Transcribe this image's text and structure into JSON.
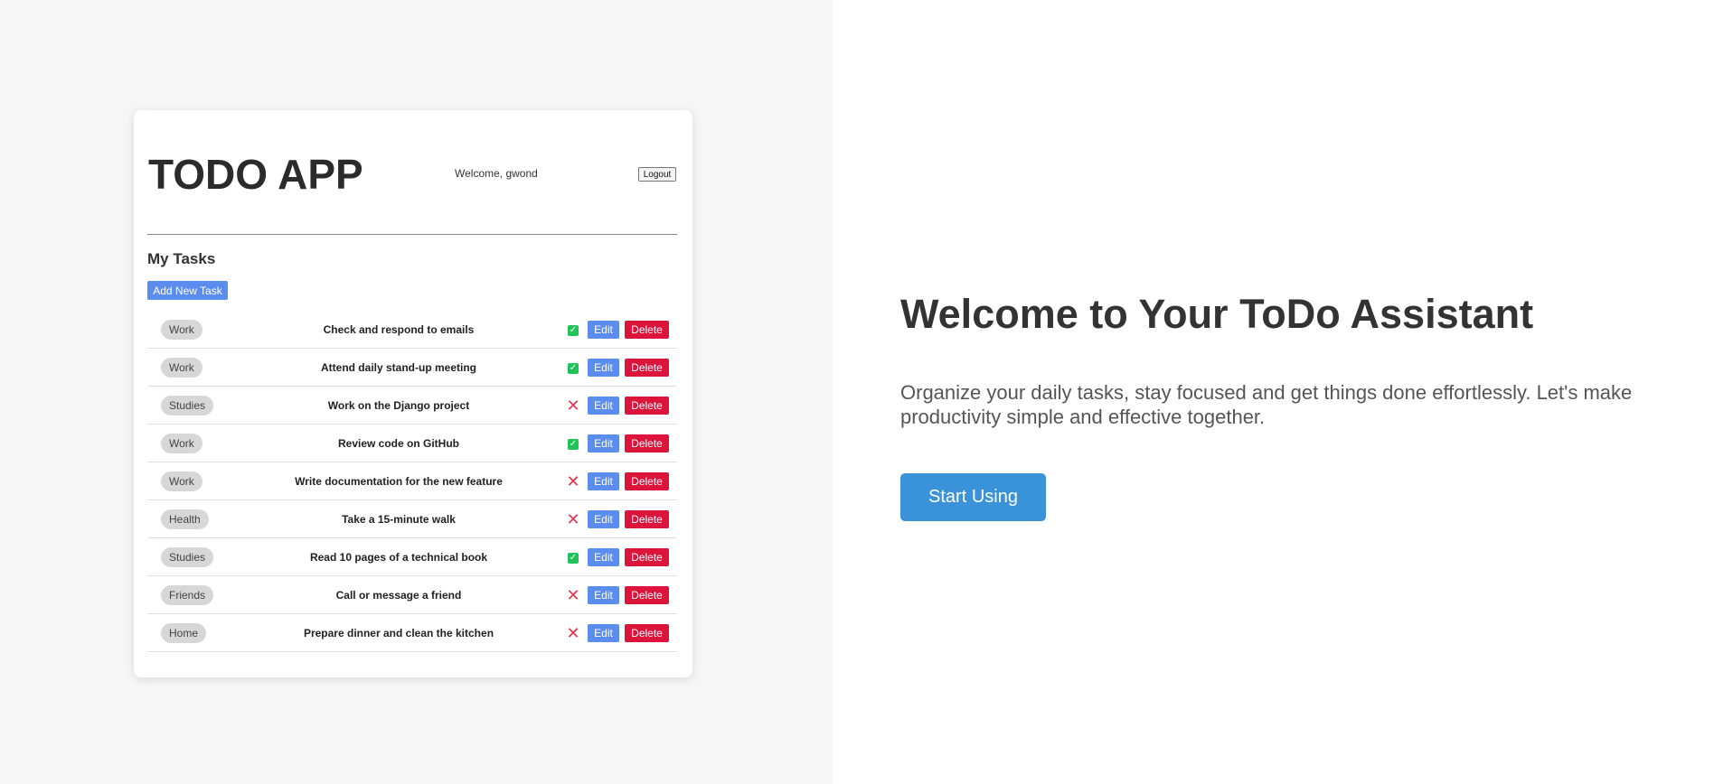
{
  "app": {
    "title": "TODO APP",
    "welcome": "Welcome, gwond",
    "logout_label": "Logout"
  },
  "tasks_section": {
    "title": "My Tasks",
    "add_button_label": "Add New Task",
    "edit_label": "Edit",
    "delete_label": "Delete",
    "items": [
      {
        "category": "Work",
        "title": "Check and respond to emails",
        "completed": true
      },
      {
        "category": "Work",
        "title": "Attend daily stand-up meeting",
        "completed": true
      },
      {
        "category": "Studies",
        "title": "Work on the Django project",
        "completed": false
      },
      {
        "category": "Work",
        "title": "Review code on GitHub",
        "completed": true
      },
      {
        "category": "Work",
        "title": "Write documentation for the new feature",
        "completed": false
      },
      {
        "category": "Health",
        "title": "Take a 15-minute walk",
        "completed": false
      },
      {
        "category": "Studies",
        "title": "Read 10 pages of a technical book",
        "completed": true
      },
      {
        "category": "Friends",
        "title": "Call or message a friend",
        "completed": false
      },
      {
        "category": "Home",
        "title": "Prepare dinner and clean the kitchen",
        "completed": false
      }
    ]
  },
  "hero": {
    "title": "Welcome to Your ToDo Assistant",
    "description": "Organize your daily tasks, stay focused and get things done effortlessly. Let's make productivity simple and effective together.",
    "cta_label": "Start Using"
  },
  "icons": {
    "completed": "check-icon",
    "pending": "cross-icon"
  },
  "colors": {
    "primary": "#5b8def",
    "danger": "#dc143c",
    "success": "#22c25a",
    "pending": "#e8344e",
    "cta": "#3a93d8",
    "left_background": "#f6f6f6"
  }
}
